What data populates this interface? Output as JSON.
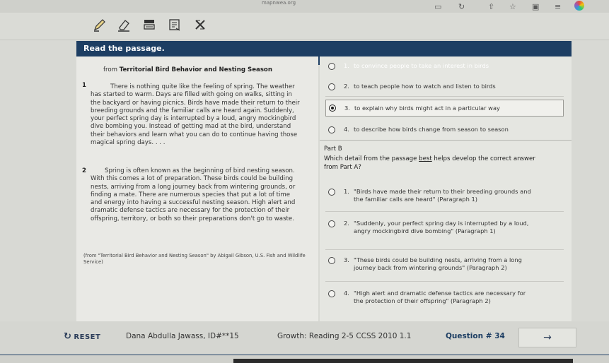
{
  "browser": {
    "url_fragment": "mapnwea.org",
    "icons": [
      "tab-icon",
      "refresh-icon",
      "share-icon",
      "star-icon",
      "tabs-count-icon",
      "menu-icon"
    ]
  },
  "toolbar": {
    "tools": [
      "pencil-icon",
      "eraser-icon",
      "highlighter-icon",
      "notepad-icon",
      "answer-eliminator-icon"
    ]
  },
  "header": {
    "title": "Read the passage."
  },
  "passage": {
    "from_prefix": "from ",
    "title": "Territorial Bird Behavior and Nesting Season",
    "paragraphs": [
      {
        "number": "1",
        "lines": [
          "There is nothing quite like the feeling of spring. The weather",
          "has started to warm. Days are filled with going on walks, sitting in",
          "the backyard or having picnics. Birds have made their return to their",
          "breeding grounds and the familiar calls are heard again. Suddenly,",
          "your perfect spring day is interrupted by a loud, angry mockingbird",
          "dive bombing you. Instead of getting mad at the bird, understand",
          "their behaviors and learn what you can do to continue having those",
          "magical spring days. . . ."
        ]
      },
      {
        "number": "2",
        "lines": [
          "Spring is often known as the beginning of bird nesting season.",
          "With this comes a lot of preparation. These birds could be building",
          "nests, arriving from a long journey back from wintering grounds, or",
          "finding a mate. There are numerous species that put a lot of time",
          "and energy into having a successful nesting season. High alert and",
          "dramatic defense tactics are necessary for the protection of their",
          "offspring, territory, or both so their preparations don't go to waste."
        ]
      }
    ],
    "credit": "(from \"Territorial Bird Behavior and Nesting Season\" by Abigail Gibson, U.S. Fish and Wildlife Service)"
  },
  "part_a": {
    "options": [
      {
        "num": "1.",
        "text": "to convince people to take an interest in birds",
        "selected": false
      },
      {
        "num": "2.",
        "text": "to teach people how to watch and listen to birds",
        "selected": false
      },
      {
        "num": "3.",
        "text": "to explain why birds might act in a particular way",
        "selected": true
      },
      {
        "num": "4.",
        "text": "to describe how birds change from season to season",
        "selected": false
      }
    ]
  },
  "part_b": {
    "label": "Part B",
    "question_before": "Which detail from the passage ",
    "question_emph": "best",
    "question_after": " helps develop the correct answer",
    "question_line2": "from Part A?",
    "options": [
      {
        "num": "1.",
        "line1": "\"Birds have made their return to their breeding grounds and",
        "line2": "the familiar calls are heard\" (Paragraph 1)"
      },
      {
        "num": "2.",
        "line1": "\"Suddenly, your perfect spring day is interrupted by a loud,",
        "line2": "angry mockingbird dive bombing\" (Paragraph 1)"
      },
      {
        "num": "3.",
        "line1": "\"These birds could be building nests, arriving from a long",
        "line2": "journey back from wintering grounds\" (Paragraph 2)"
      },
      {
        "num": "4.",
        "line1": "\"High alert and dramatic defense tactics are necessary for",
        "line2": "the protection of their offspring\" (Paragraph 2)"
      }
    ]
  },
  "footer": {
    "reset_label": "RESET",
    "student_name": "Dana Abdulla Jawass, ID#**15",
    "growth_label": "Growth: Reading 2-5 CCSS 2010 1.1",
    "question_label": "Question # 34",
    "next_icon": "arrow-right-icon"
  },
  "colors": {
    "header": "#1d3e63",
    "page_bg": "#d8d9d4",
    "passage_bg": "#e9e9e5"
  }
}
